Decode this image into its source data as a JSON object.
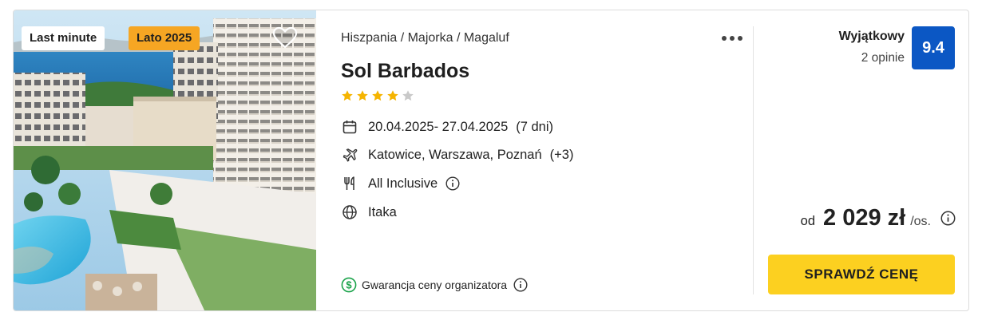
{
  "photo": {
    "badges": {
      "last_minute": "Last minute",
      "season": "Lato 2025"
    },
    "season_badge_color": "#f6a623"
  },
  "offer": {
    "breadcrumb": "Hiszpania / Majorka / Magaluf",
    "hotel_name": "Sol Barbados",
    "stars": 4,
    "max_stars": 5,
    "dates": "20.04.2025- 27.04.2025",
    "duration": "(7 dni)",
    "departures": "Katowice, Warszawa, Poznań",
    "departures_more": "(+3)",
    "board": "All Inclusive",
    "operator": "Itaka",
    "guarantee": "Gwarancja ceny organizatora"
  },
  "rating": {
    "label": "Wyjątkowy",
    "count": "2 opinie",
    "score": "9.4",
    "badge_color": "#0b57c4"
  },
  "price": {
    "from_label": "od",
    "amount": "2 029 zł",
    "per_person": "/os."
  },
  "cta": {
    "label": "SPRAWDŹ CENĘ",
    "color": "#fcd020"
  },
  "icons": {
    "favorite": "heart-icon",
    "more": "more-dots-icon",
    "date": "calendar-icon",
    "departure": "plane-icon",
    "board": "cutlery-icon",
    "operator": "globe-icon",
    "info": "info-icon",
    "guarantee": "dollar-circle-icon",
    "star": "star-icon"
  }
}
